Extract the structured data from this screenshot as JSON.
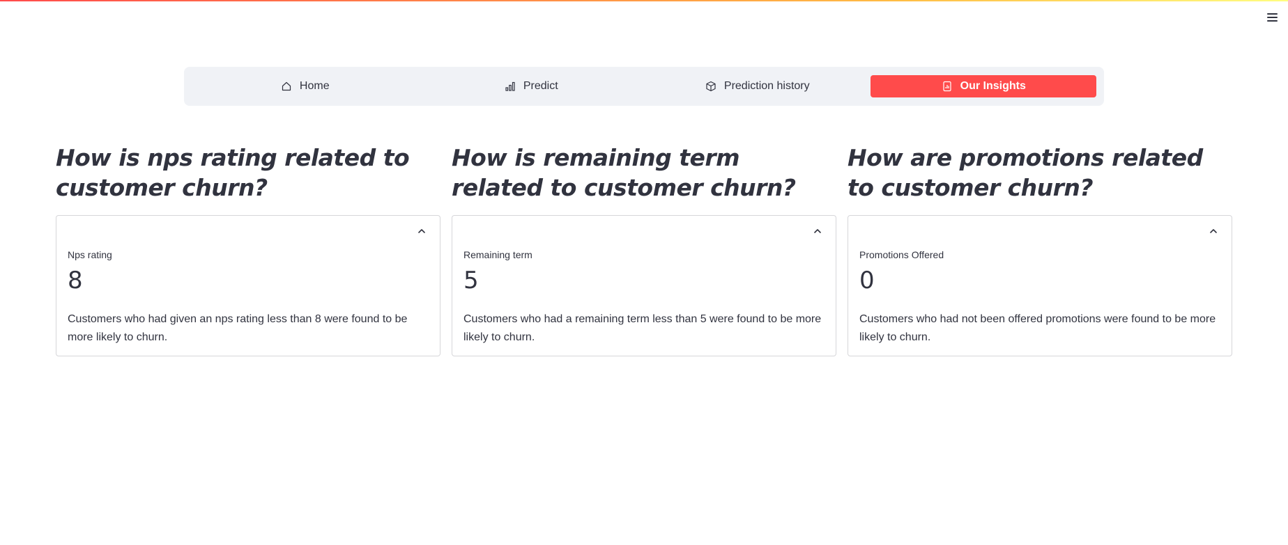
{
  "nav": {
    "items": [
      {
        "label": "Home",
        "icon": "home-icon",
        "active": false
      },
      {
        "label": "Predict",
        "icon": "bar-chart-icon",
        "active": false
      },
      {
        "label": "Prediction history",
        "icon": "box-icon",
        "active": false
      },
      {
        "label": "Our Insights",
        "icon": "report-icon",
        "active": true
      }
    ],
    "active_color": "#ff4b4b"
  },
  "insights": [
    {
      "title": "How is nps rating related to customer churn?",
      "metric_label": "Nps rating",
      "metric_value": "8",
      "description": "Customers who had given an nps rating less than 8 were found to be more likely to churn."
    },
    {
      "title": "How is remaining term related to customer churn?",
      "metric_label": "Remaining term",
      "metric_value": "5",
      "description": "Customers who had a remaining term less than 5 were found to be more likely to churn."
    },
    {
      "title": "How are promotions related to customer churn?",
      "metric_label": "Promotions Offered",
      "metric_value": "0",
      "description": "Customers who had not been offered promotions were found to be more likely to churn."
    }
  ]
}
